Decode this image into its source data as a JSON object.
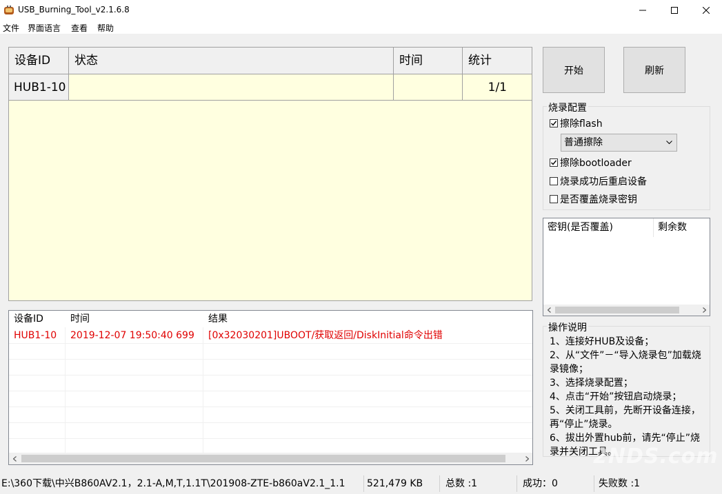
{
  "window": {
    "title": "USB_Burning_Tool_v2.1.6.8"
  },
  "menu": {
    "items": [
      "文件",
      "界面语言",
      "查看",
      "帮助"
    ]
  },
  "device_grid": {
    "columns": [
      "设备ID",
      "状态",
      "时间",
      "统计"
    ],
    "rows": [
      {
        "id": "HUB1-10",
        "status": "",
        "time": "",
        "count": "1/1"
      }
    ]
  },
  "buttons": {
    "start": "开始",
    "refresh": "刷新"
  },
  "burn_config": {
    "title": "烧录配置",
    "erase_flash": {
      "label": "擦除flash",
      "checked": true
    },
    "erase_mode": "普通擦除",
    "erase_bootloader": {
      "label": "擦除bootloader",
      "checked": true
    },
    "reboot_after": {
      "label": "烧录成功后重启设备",
      "checked": false
    },
    "overwrite_key": {
      "label": "是否覆盖烧录密钥",
      "checked": false
    }
  },
  "key_list": {
    "columns": [
      "密钥(是否覆盖)",
      "剩余数"
    ]
  },
  "log": {
    "columns": [
      "设备ID",
      "时间",
      "结果"
    ],
    "rows": [
      {
        "id": "HUB1-10",
        "time": "2019-12-07 19:50:40 699",
        "result": "[0x32030201]UBOOT/获取返回/DiskInitial命令出错"
      }
    ],
    "error_color": "#e00000"
  },
  "instructions": {
    "title": "操作说明",
    "text": "1、连接好HUB及设备；\n2、从“文件”－“导入烧录包”加载烧录镜像；\n3、选择烧录配置；\n4、点击“开始”按钮启动烧录；\n5、关闭工具前，先断开设备连接，再“停止”烧录。\n6、拔出外置hub前，请先“停止”烧录并关闭工具。"
  },
  "status_bar": {
    "path": "E:\\360下载\\中兴B860AV2.1，2.1-A,M,T,1.1T\\201908-ZTE-b860aV2.1_1.1",
    "size": "521,479 KB",
    "total": "总数 :1",
    "success": "成功：0",
    "fail": "失败数 :1"
  },
  "watermark": "2NDS.com"
}
